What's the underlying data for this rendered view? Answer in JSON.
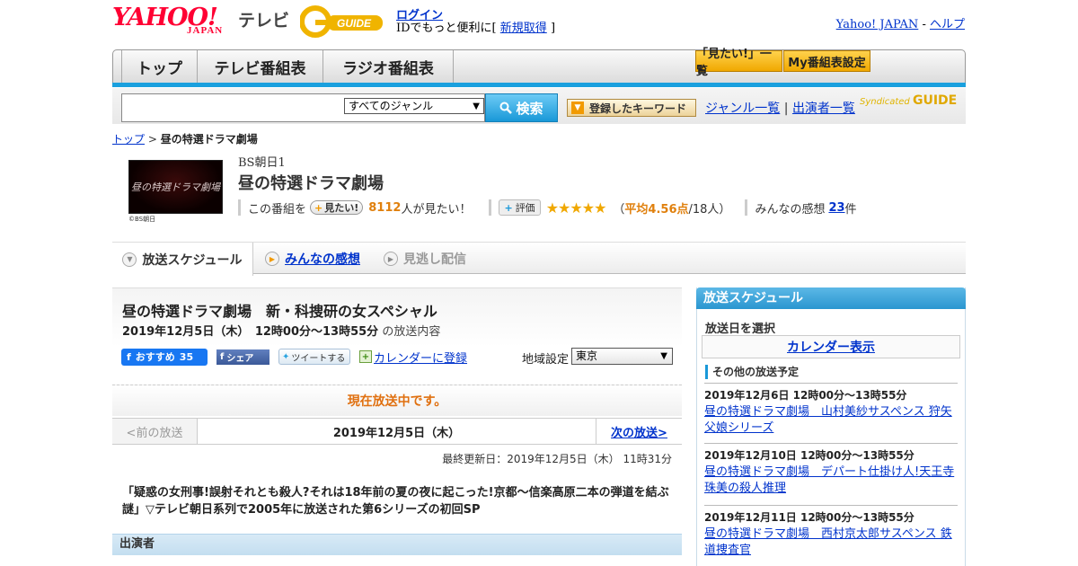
{
  "header": {
    "brand": "YAHOO!",
    "brand_sub": "JAPAN",
    "service": "テレビ",
    "guide_logo": "G GUIDE",
    "login_label": "ログイン",
    "id_prefix": "IDでもっと便利に[",
    "signup_label": "新規取得",
    "id_suffix": "]",
    "yahoo_japan_label": "Yahoo! JAPAN",
    "separator": "-",
    "help_label": "ヘルプ"
  },
  "nav": {
    "tabs": [
      "トップ",
      "テレビ番組表",
      "ラジオ番組表"
    ],
    "mitai_list_label": "「見たい!」一覧",
    "my_bangumi_label": "My番組表設定"
  },
  "search": {
    "placeholder": "",
    "genre_selected": "すべてのジャンル",
    "search_button": "検索",
    "keyword_button": "登録したキーワード",
    "genre_list_label": "ジャンル一覧",
    "divider": "|",
    "cast_list_label": "出演者一覧",
    "syndicated_label": "Syndicated",
    "syndicated_logo": "GUIDE"
  },
  "breadcrumb": {
    "top_label": "トップ",
    "sep": ">",
    "current": "昼の特選ドラマ劇場"
  },
  "program": {
    "thumb_text": "昼の特選ドラマ劇場",
    "thumb_caption": "©BS朝日",
    "channel": "BS朝日1",
    "title": "昼の特選ドラマ劇場",
    "mitai_prefix": "この番組を",
    "mitai_button": "見たい!",
    "mitai_count": "8112",
    "mitai_suffix": "人が見たい！",
    "hyoka_button": "評価",
    "stars": "★★★★★",
    "rating_open": "（",
    "rating_avg": "平均4.56点",
    "rating_count": "/18人）",
    "impressions_label": "みんなの感想",
    "impressions_count": "23",
    "impressions_suffix": "件",
    "rating_value": 4.56
  },
  "tabs": {
    "schedule": "放送スケジュール",
    "impressions": "みんなの感想",
    "missed": "見逃し配信"
  },
  "episode": {
    "title": "昼の特選ドラマ劇場　新・科捜研の女スペシャル",
    "date_bold": "2019年12月5日（木）　12時00分～13時55分",
    "date_rest": "の放送内容",
    "fb_like": "おすすめ",
    "fb_count": "35",
    "fb_share": "シェア",
    "tweet": "ツイートする",
    "calendar_label": "カレンダーに登録",
    "region_label": "地域設定",
    "region_value": "東京",
    "onair_text": "現在放送中です。",
    "prev_label": "<前の放送",
    "current_date": "2019年12月5日（木）",
    "next_label": "次の放送>",
    "updated": "最終更新日：2019年12月5日（木） 11時31分",
    "description": "「疑惑の女刑事!誤射それとも殺人?それは18年前の夏の夜に起こった!京都～信楽高原二本の弾道を結ぶ謎」▽テレビ朝日系列で2005年に放送された第6シリーズの初回SP",
    "cast_header": "出演者"
  },
  "sidebar": {
    "header": "放送スケジュール",
    "select_date_label": "放送日を選択",
    "calendar_button": "カレンダー表示",
    "other_label": "その他の放送予定",
    "items": [
      {
        "date": "2019年12月6日 12時00分～13時55分",
        "title": "昼の特選ドラマ劇場　山村美紗サスペンス 狩矢父娘シリーズ"
      },
      {
        "date": "2019年12月10日 12時00分～13時55分",
        "title": "昼の特選ドラマ劇場　デパート仕掛け人!天王寺珠美の殺人推理"
      },
      {
        "date": "2019年12月11日 12時00分～13時55分",
        "title": "昼の特選ドラマ劇場　西村京太郎サスペンス 鉄道捜査官"
      }
    ]
  },
  "colors": {
    "brand_red": "#ff0033",
    "accent_blue": "#1998d8",
    "link": "#0033cc",
    "onair_orange": "#e07010",
    "star": "#f0a800"
  }
}
